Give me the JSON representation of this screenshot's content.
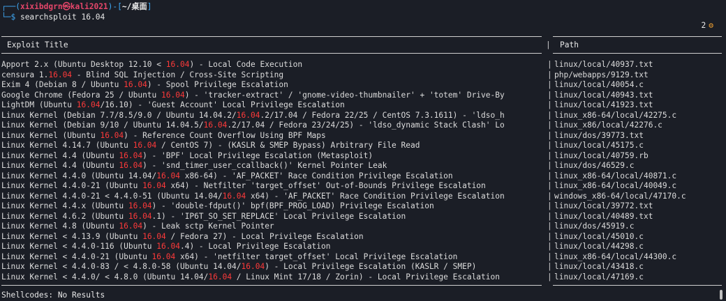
{
  "prompt": {
    "open": "┌──(",
    "user": "xixibdgrn",
    "at": "㉿",
    "host": "kali2021",
    "mid": ")-[",
    "path": "~/桌面",
    "close": "]",
    "arrow": "└─$ ",
    "command": "searchsploit 16.04"
  },
  "status_badge": {
    "count": "2",
    "icon": "gear-icon",
    "glyph": "⚙"
  },
  "colors": {
    "highlight": "#ff3a3a",
    "prompt": "#3fa9f5",
    "user": "#e5466a",
    "gear": "#f0a030"
  },
  "table": {
    "col_title": "Exploit Title",
    "col_path": "Path",
    "separator": "|",
    "highlight_term": "16.04",
    "rows": [
      {
        "title": "Apport 2.x (Ubuntu Desktop 12.10 < 16.04) - Local Code Execution",
        "path": "linux/local/40937.txt"
      },
      {
        "title": "censura 1.16.04 - Blind SQL Injection / Cross-Site Scripting",
        "path": "php/webapps/9129.txt"
      },
      {
        "title": "Exim 4 (Debian 8 / Ubuntu 16.04) - Spool Privilege Escalation",
        "path": "linux/local/40054.c"
      },
      {
        "title": "Google Chrome (Fedora 25 / Ubuntu 16.04) - 'tracker-extract' / 'gnome-video-thumbnailer' + 'totem' Drive-By",
        "path": "linux/local/40943.txt"
      },
      {
        "title": "LightDM (Ubuntu 16.04/16.10) - 'Guest Account' Local Privilege Escalation",
        "path": "linux/local/41923.txt"
      },
      {
        "title": "Linux Kernel (Debian 7.7/8.5/9.0 / Ubuntu 14.04.2/16.04.2/17.04 / Fedora 22/25 / CentOS 7.3.1611) - 'ldso_h",
        "path": "linux_x86-64/local/42275.c"
      },
      {
        "title": "Linux Kernel (Debian 9/10 / Ubuntu 14.04.5/16.04.2/17.04 / Fedora 23/24/25) - 'ldso_dynamic Stack Clash' Lo",
        "path": "linux_x86/local/42276.c"
      },
      {
        "title": "Linux Kernel (Ubuntu 16.04) - Reference Count Overflow Using BPF Maps",
        "path": "linux/dos/39773.txt"
      },
      {
        "title": "Linux Kernel 4.14.7 (Ubuntu 16.04 / CentOS 7) - (KASLR & SMEP Bypass) Arbitrary File Read",
        "path": "linux/local/45175.c"
      },
      {
        "title": "Linux Kernel 4.4 (Ubuntu 16.04) - 'BPF' Local Privilege Escalation (Metasploit)",
        "path": "linux/local/40759.rb"
      },
      {
        "title": "Linux Kernel 4.4 (Ubuntu 16.04) - 'snd_timer_user_ccallback()' Kernel Pointer Leak",
        "path": "linux/dos/46529.c"
      },
      {
        "title": "Linux Kernel 4.4.0 (Ubuntu 14.04/16.04 x86-64) - 'AF_PACKET' Race Condition Privilege Escalation",
        "path": "linux_x86-64/local/40871.c"
      },
      {
        "title": "Linux Kernel 4.4.0-21 (Ubuntu 16.04 x64) - Netfilter 'target_offset' Out-of-Bounds Privilege Escalation",
        "path": "linux_x86-64/local/40049.c"
      },
      {
        "title": "Linux Kernel 4.4.0-21 < 4.4.0-51 (Ubuntu 14.04/16.04 x64) - 'AF_PACKET' Race Condition Privilege Escalation",
        "path": "windows_x86-64/local/47170.c"
      },
      {
        "title": "Linux Kernel 4.4.x (Ubuntu 16.04) - 'double-fdput()' bpf(BPF_PROG_LOAD) Privilege Escalation",
        "path": "linux/local/39772.txt"
      },
      {
        "title": "Linux Kernel 4.6.2 (Ubuntu 16.04.1) - 'IP6T_SO_SET_REPLACE' Local Privilege Escalation",
        "path": "linux/local/40489.txt"
      },
      {
        "title": "Linux Kernel 4.8 (Ubuntu 16.04) - Leak sctp Kernel Pointer",
        "path": "linux/dos/45919.c"
      },
      {
        "title": "Linux Kernel < 4.13.9 (Ubuntu 16.04 / Fedora 27) - Local Privilege Escalation",
        "path": "linux/local/45010.c"
      },
      {
        "title": "Linux Kernel < 4.4.0-116 (Ubuntu 16.04.4) - Local Privilege Escalation",
        "path": "linux/local/44298.c"
      },
      {
        "title": "Linux Kernel < 4.4.0-21 (Ubuntu 16.04 x64) - 'netfilter target_offset' Local Privilege Escalation",
        "path": "linux_x86-64/local/44300.c"
      },
      {
        "title": "Linux Kernel < 4.4.0-83 / < 4.8.0-58 (Ubuntu 14.04/16.04) - Local Privilege Escalation (KASLR / SMEP)",
        "path": "linux/local/43418.c"
      },
      {
        "title": "Linux Kernel < 4.4.0/ < 4.8.0 (Ubuntu 14.04/16.04 / Linux Mint 17/18 / Zorin) - Local Privilege Escalation",
        "path": "linux/local/47169.c"
      }
    ]
  },
  "shellcodes": "Shellcodes: No Results"
}
